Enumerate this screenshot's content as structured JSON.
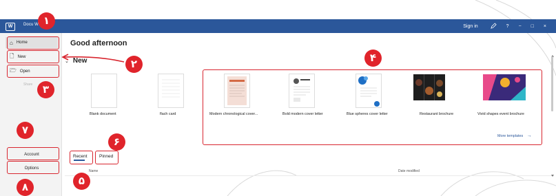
{
  "window": {
    "app_icon": "word-icon",
    "title": "Docu Word",
    "signin": "Sign in",
    "pen_icon": "pen-icon",
    "help": "?",
    "minimize": "−",
    "maximize": "□",
    "close": "×"
  },
  "sidebar": {
    "home": "Home",
    "new": "New",
    "open": "Open",
    "share": "Share",
    "account": "Account",
    "options": "Options"
  },
  "main": {
    "greeting": "Good afternoon",
    "new_heading": "New",
    "templates": [
      {
        "label": "Blank document"
      },
      {
        "label": "flach card"
      },
      {
        "label": "Modern chronological cover..."
      },
      {
        "label": "Bold modern cover letter"
      },
      {
        "label": "Blue spheres cover letter"
      },
      {
        "label": "Restaurant brochure"
      },
      {
        "label": "Vivid shapes event brochure"
      }
    ],
    "more_templates": "More templates",
    "more_arrow": "→",
    "tabs": [
      "Recent",
      "Pinned"
    ],
    "columns": [
      "Name",
      "Date modified"
    ]
  },
  "annotations": [
    "۱",
    "۲",
    "۳",
    "۴",
    "۵",
    "۶",
    "۷",
    "۸"
  ],
  "colors": {
    "titlebar": "#2b579a",
    "accent": "#2b579a",
    "annotation_red": "#e0242b",
    "sidebar_bg": "#f3f3f3"
  }
}
